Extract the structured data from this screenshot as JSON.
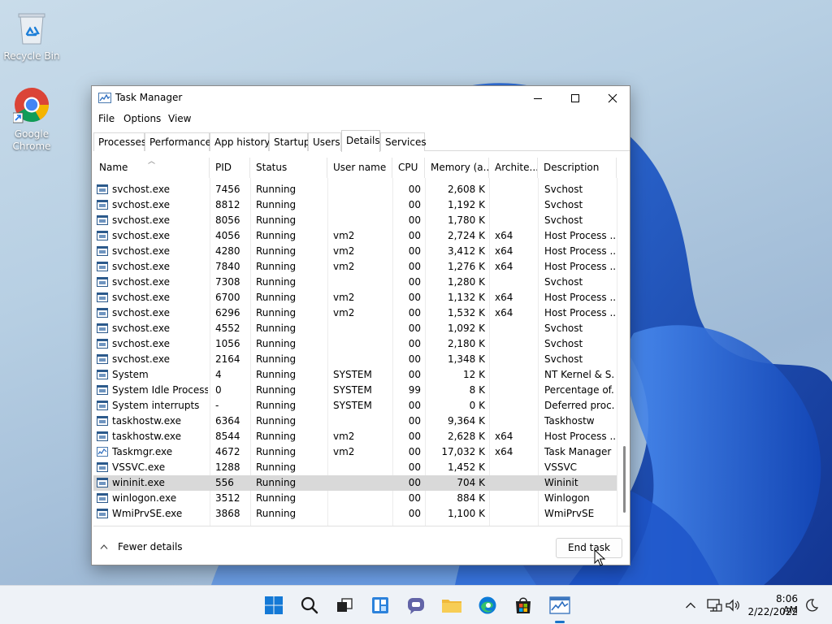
{
  "desktop": {
    "icons": [
      {
        "label": "Recycle Bin"
      },
      {
        "label": "Google Chrome"
      }
    ]
  },
  "window": {
    "title": "Task Manager",
    "menu": [
      "File",
      "Options",
      "View"
    ],
    "tabs": [
      "Processes",
      "Performance",
      "App history",
      "Startup",
      "Users",
      "Details",
      "Services"
    ],
    "active_tab": "Details",
    "columns": [
      "Name",
      "PID",
      "Status",
      "User name",
      "CPU",
      "Memory (a...",
      "Archite...",
      "Description"
    ],
    "rows": [
      {
        "name": "svchost.exe",
        "pid": "7456",
        "status": "Running",
        "user": "",
        "cpu": "00",
        "memory": "2,608 K",
        "arch": "",
        "desc": "Svchost"
      },
      {
        "name": "svchost.exe",
        "pid": "8812",
        "status": "Running",
        "user": "",
        "cpu": "00",
        "memory": "1,192 K",
        "arch": "",
        "desc": "Svchost"
      },
      {
        "name": "svchost.exe",
        "pid": "8056",
        "status": "Running",
        "user": "",
        "cpu": "00",
        "memory": "1,780 K",
        "arch": "",
        "desc": "Svchost"
      },
      {
        "name": "svchost.exe",
        "pid": "4056",
        "status": "Running",
        "user": "vm2",
        "cpu": "00",
        "memory": "2,724 K",
        "arch": "x64",
        "desc": "Host Process ..."
      },
      {
        "name": "svchost.exe",
        "pid": "4280",
        "status": "Running",
        "user": "vm2",
        "cpu": "00",
        "memory": "3,412 K",
        "arch": "x64",
        "desc": "Host Process ..."
      },
      {
        "name": "svchost.exe",
        "pid": "7840",
        "status": "Running",
        "user": "vm2",
        "cpu": "00",
        "memory": "1,276 K",
        "arch": "x64",
        "desc": "Host Process ..."
      },
      {
        "name": "svchost.exe",
        "pid": "7308",
        "status": "Running",
        "user": "",
        "cpu": "00",
        "memory": "1,280 K",
        "arch": "",
        "desc": "Svchost"
      },
      {
        "name": "svchost.exe",
        "pid": "6700",
        "status": "Running",
        "user": "vm2",
        "cpu": "00",
        "memory": "1,132 K",
        "arch": "x64",
        "desc": "Host Process ..."
      },
      {
        "name": "svchost.exe",
        "pid": "6296",
        "status": "Running",
        "user": "vm2",
        "cpu": "00",
        "memory": "1,532 K",
        "arch": "x64",
        "desc": "Host Process ..."
      },
      {
        "name": "svchost.exe",
        "pid": "4552",
        "status": "Running",
        "user": "",
        "cpu": "00",
        "memory": "1,092 K",
        "arch": "",
        "desc": "Svchost"
      },
      {
        "name": "svchost.exe",
        "pid": "1056",
        "status": "Running",
        "user": "",
        "cpu": "00",
        "memory": "2,180 K",
        "arch": "",
        "desc": "Svchost"
      },
      {
        "name": "svchost.exe",
        "pid": "2164",
        "status": "Running",
        "user": "",
        "cpu": "00",
        "memory": "1,348 K",
        "arch": "",
        "desc": "Svchost"
      },
      {
        "name": "System",
        "pid": "4",
        "status": "Running",
        "user": "SYSTEM",
        "cpu": "00",
        "memory": "12 K",
        "arch": "",
        "desc": "NT Kernel & S..."
      },
      {
        "name": "System Idle Process",
        "pid": "0",
        "status": "Running",
        "user": "SYSTEM",
        "cpu": "99",
        "memory": "8 K",
        "arch": "",
        "desc": "Percentage of..."
      },
      {
        "name": "System interrupts",
        "pid": "-",
        "status": "Running",
        "user": "SYSTEM",
        "cpu": "00",
        "memory": "0 K",
        "arch": "",
        "desc": "Deferred proc..."
      },
      {
        "name": "taskhostw.exe",
        "pid": "6364",
        "status": "Running",
        "user": "",
        "cpu": "00",
        "memory": "9,364 K",
        "arch": "",
        "desc": "Taskhostw"
      },
      {
        "name": "taskhostw.exe",
        "pid": "8544",
        "status": "Running",
        "user": "vm2",
        "cpu": "00",
        "memory": "2,628 K",
        "arch": "x64",
        "desc": "Host Process ..."
      },
      {
        "name": "Taskmgr.exe",
        "pid": "4672",
        "status": "Running",
        "user": "vm2",
        "cpu": "00",
        "memory": "17,032 K",
        "arch": "x64",
        "desc": "Task Manager"
      },
      {
        "name": "VSSVC.exe",
        "pid": "1288",
        "status": "Running",
        "user": "",
        "cpu": "00",
        "memory": "1,452 K",
        "arch": "",
        "desc": "VSSVC"
      },
      {
        "name": "wininit.exe",
        "pid": "556",
        "status": "Running",
        "user": "",
        "cpu": "00",
        "memory": "704 K",
        "arch": "",
        "desc": "Wininit"
      },
      {
        "name": "winlogon.exe",
        "pid": "3512",
        "status": "Running",
        "user": "",
        "cpu": "00",
        "memory": "884 K",
        "arch": "",
        "desc": "Winlogon"
      },
      {
        "name": "WmiPrvSE.exe",
        "pid": "3868",
        "status": "Running",
        "user": "",
        "cpu": "00",
        "memory": "1,100 K",
        "arch": "",
        "desc": "WmiPrvSE"
      }
    ],
    "selected_row": "wininit.exe",
    "footer": {
      "fewer_details": "Fewer details",
      "end_task": "End task"
    }
  },
  "taskbar": {
    "time": "8:06 AM",
    "date": "2/22/2022",
    "pinned": [
      "start-icon",
      "search-icon",
      "task-view-icon",
      "widgets-icon",
      "chat-icon",
      "file-explorer-icon",
      "edge-icon",
      "store-icon",
      "task-manager-icon"
    ],
    "active_app": "task-manager-icon"
  }
}
